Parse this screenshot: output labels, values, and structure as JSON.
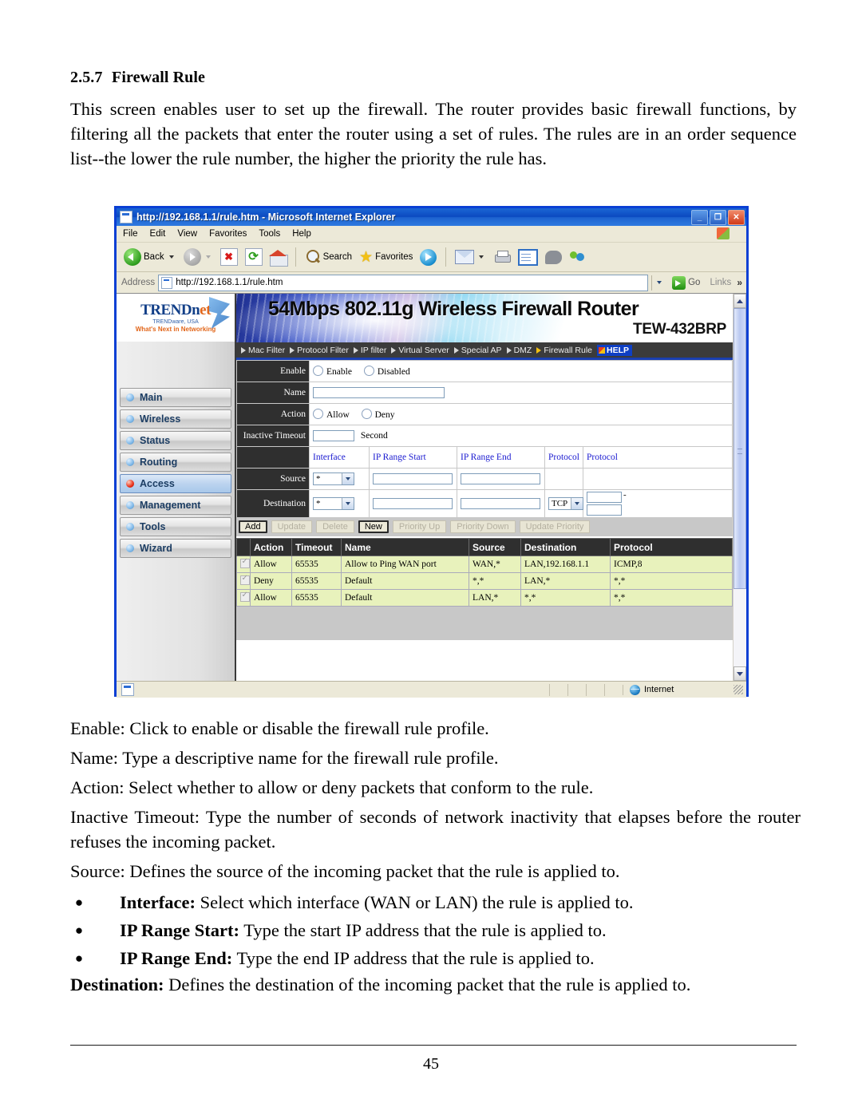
{
  "section": {
    "number": "2.5.7",
    "title": "Firewall Rule",
    "intro": "This screen enables user to set up the firewall. The router provides basic firewall functions, by filtering all the packets that enter the router using a set of rules. The rules are in an order sequence list--the lower the rule number, the higher the priority the rule has."
  },
  "descriptions": {
    "enable": "Enable: Click to enable or disable the firewall rule profile.",
    "name": "Name: Type a descriptive name for the firewall rule profile.",
    "action": "Action: Select whether to allow or deny packets that conform to the rule.",
    "inactive_timeout": "Inactive Timeout: Type the number of seconds of network inactivity that elapses before the router refuses the incoming packet.",
    "source": "Source: Defines the source of the incoming packet that the rule is applied to.",
    "bullets": [
      {
        "term": "Interface:",
        "text": " Select which interface (WAN or LAN) the rule is applied to."
      },
      {
        "term": "IP Range Start:",
        "text": " Type the start IP address that the rule is applied to."
      },
      {
        "term": "IP Range End:",
        "text": " Type the end IP address that the rule is applied to."
      }
    ],
    "destination_term": "Destination:",
    "destination_text": " Defines the destination of the incoming packet that the rule is applied to."
  },
  "page_number": "45",
  "browser": {
    "title": "http://192.168.1.1/rule.htm - Microsoft Internet Explorer",
    "window_buttons": {
      "minimize": "_",
      "maximize": "❐",
      "close": "✕"
    },
    "menu": [
      "File",
      "Edit",
      "View",
      "Favorites",
      "Tools",
      "Help"
    ],
    "toolbar": {
      "back_label": "Back",
      "search_label": "Search",
      "favorites_label": "Favorites"
    },
    "address": {
      "label": "Address",
      "url": "http://192.168.1.1/rule.htm",
      "go_label": "Go",
      "links_label": "Links",
      "chevron": "»"
    },
    "status": {
      "zone": "Internet"
    }
  },
  "router": {
    "logo": {
      "brand_a": "TRENDnet",
      "brand_prefix": "TRENDn",
      "brand_suffix": "et",
      "company": "TRENDware, USA",
      "tagline": "What's Next in Networking"
    },
    "banner": {
      "title": "54Mbps 802.11g Wireless Firewall Router",
      "model": "TEW-432BRP"
    },
    "nav_tabs": [
      {
        "label": "Mac Filter",
        "active": false
      },
      {
        "label": "Protocol Filter",
        "active": false
      },
      {
        "label": "IP filter",
        "active": false
      },
      {
        "label": "Virtual Server",
        "active": false
      },
      {
        "label": "Special AP",
        "active": false
      },
      {
        "label": "DMZ",
        "active": false
      },
      {
        "label": "Firewall Rule",
        "active": true
      }
    ],
    "help_label": "HELP",
    "sidebar": [
      {
        "label": "Main",
        "selected": false
      },
      {
        "label": "Wireless",
        "selected": false
      },
      {
        "label": "Status",
        "selected": false
      },
      {
        "label": "Routing",
        "selected": false
      },
      {
        "label": "Access",
        "selected": true
      },
      {
        "label": "Management",
        "selected": false
      },
      {
        "label": "Tools",
        "selected": false
      },
      {
        "label": "Wizard",
        "selected": false
      }
    ],
    "form": {
      "enable_label": "Enable",
      "enable_option_on": "Enable",
      "enable_option_off": "Disabled",
      "name_label": "Name",
      "name_value": "",
      "action_label": "Action",
      "action_option_allow": "Allow",
      "action_option_deny": "Deny",
      "timeout_label": "Inactive Timeout",
      "timeout_value": "",
      "timeout_unit": "Second",
      "col_interface": "Interface",
      "col_ip_start": "IP Range Start",
      "col_ip_end": "IP Range End",
      "col_protocol_1": "Protocol",
      "col_protocol_2": "Protocol",
      "source_label": "Source",
      "source_interface": "*",
      "source_ip_start": "",
      "source_ip_end": "",
      "destination_label": "Destination",
      "destination_interface": "*",
      "destination_ip_start": "",
      "destination_ip_end": "",
      "destination_protocol": "TCP",
      "port_start": "",
      "port_end": "",
      "port_dash": "-"
    },
    "buttons": [
      {
        "label": "Add",
        "enabled": true
      },
      {
        "label": "Update",
        "enabled": false
      },
      {
        "label": "Delete",
        "enabled": false
      },
      {
        "label": "New",
        "enabled": true
      },
      {
        "label": "Priority Up",
        "enabled": false
      },
      {
        "label": "Priority Down",
        "enabled": false
      },
      {
        "label": "Update Priority",
        "enabled": false
      }
    ],
    "rules_table": {
      "headers": [
        "Action",
        "Timeout",
        "Name",
        "Source",
        "Destination",
        "Protocol"
      ],
      "rows": [
        {
          "checked": true,
          "action": "Allow",
          "timeout": "65535",
          "name": "Allow to Ping WAN port",
          "source": "WAN,*",
          "destination": "LAN,192.168.1.1",
          "protocol": "ICMP,8"
        },
        {
          "checked": true,
          "action": "Deny",
          "timeout": "65535",
          "name": "Default",
          "source": "*,*",
          "destination": "LAN,*",
          "protocol": "*,*"
        },
        {
          "checked": true,
          "action": "Allow",
          "timeout": "65535",
          "name": "Default",
          "source": "LAN,*",
          "destination": "*,*",
          "protocol": "*,*"
        }
      ]
    }
  }
}
